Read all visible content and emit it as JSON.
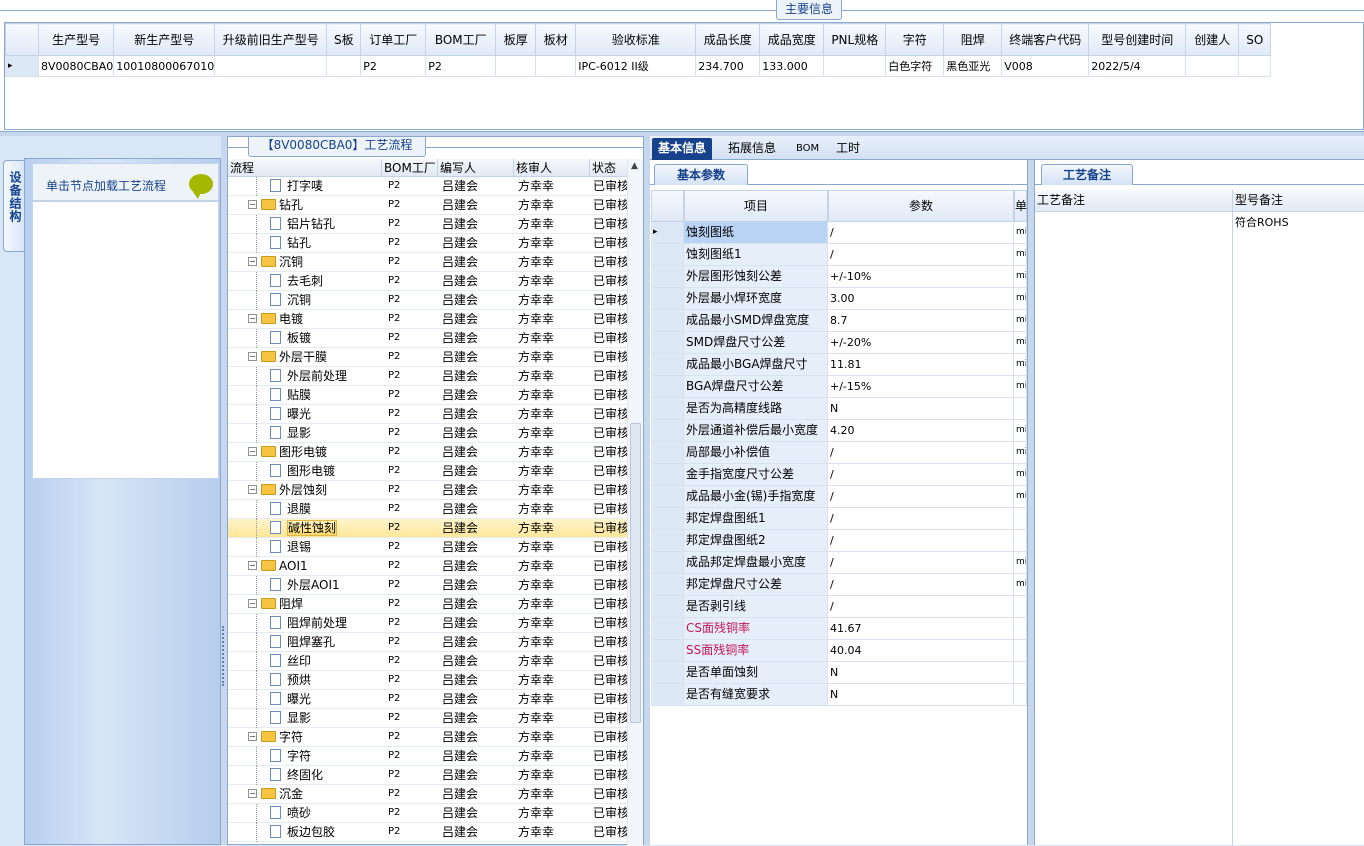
{
  "main_info": {
    "title": "主要信息",
    "columns": [
      "生产型号",
      "新生产型号",
      "升级前旧生产型号",
      "S板",
      "订单工厂",
      "BOM工厂",
      "板厚",
      "板材",
      "验收标准",
      "成品长度",
      "成品宽度",
      "PNL规格",
      "字符",
      "阻焊",
      "终端客户代码",
      "型号创建时间",
      "创建人",
      "SO"
    ],
    "row": [
      "8V0080CBA0",
      "10010800067010",
      "",
      "",
      "P2",
      "P2",
      "",
      "",
      "IPC-6012 II级",
      "234.700",
      "133.000",
      "",
      "白色字符",
      "黑色亚光",
      "V008",
      "2022/5/4",
      "",
      ""
    ]
  },
  "left_panel": {
    "tab_label": "设备结构",
    "hint": "单击节点加载工艺流程"
  },
  "flow_panel": {
    "title": "【8V0080CBA0】工艺流程",
    "columns": [
      "流程",
      "BOM工厂",
      "编写人",
      "核审人",
      "状态"
    ],
    "rows": [
      {
        "name": "打字唛",
        "level": 2,
        "type": "doc",
        "bom": "P2",
        "writer": "吕建会",
        "reviewer": "方幸幸",
        "status": "已审核"
      },
      {
        "name": "钻孔",
        "level": 1,
        "type": "folder",
        "bom": "P2",
        "writer": "吕建会",
        "reviewer": "方幸幸",
        "status": "已审核"
      },
      {
        "name": "铝片钻孔",
        "level": 2,
        "type": "doc",
        "bom": "P2",
        "writer": "吕建会",
        "reviewer": "方幸幸",
        "status": "已审核"
      },
      {
        "name": "钻孔",
        "level": 2,
        "type": "doc",
        "bom": "P2",
        "writer": "吕建会",
        "reviewer": "方幸幸",
        "status": "已审核"
      },
      {
        "name": "沉铜",
        "level": 1,
        "type": "folder",
        "bom": "P2",
        "writer": "吕建会",
        "reviewer": "方幸幸",
        "status": "已审核"
      },
      {
        "name": "去毛刺",
        "level": 2,
        "type": "doc",
        "bom": "P2",
        "writer": "吕建会",
        "reviewer": "方幸幸",
        "status": "已审核"
      },
      {
        "name": "沉铜",
        "level": 2,
        "type": "doc",
        "bom": "P2",
        "writer": "吕建会",
        "reviewer": "方幸幸",
        "status": "已审核"
      },
      {
        "name": "电镀",
        "level": 1,
        "type": "folder",
        "bom": "P2",
        "writer": "吕建会",
        "reviewer": "方幸幸",
        "status": "已审核"
      },
      {
        "name": "板镀",
        "level": 2,
        "type": "doc",
        "bom": "P2",
        "writer": "吕建会",
        "reviewer": "方幸幸",
        "status": "已审核"
      },
      {
        "name": "外层干膜",
        "level": 1,
        "type": "folder",
        "bom": "P2",
        "writer": "吕建会",
        "reviewer": "方幸幸",
        "status": "已审核"
      },
      {
        "name": "外层前处理",
        "level": 2,
        "type": "doc",
        "bom": "P2",
        "writer": "吕建会",
        "reviewer": "方幸幸",
        "status": "已审核"
      },
      {
        "name": "贴膜",
        "level": 2,
        "type": "doc",
        "bom": "P2",
        "writer": "吕建会",
        "reviewer": "方幸幸",
        "status": "已审核"
      },
      {
        "name": "曝光",
        "level": 2,
        "type": "doc",
        "bom": "P2",
        "writer": "吕建会",
        "reviewer": "方幸幸",
        "status": "已审核"
      },
      {
        "name": "显影",
        "level": 2,
        "type": "doc",
        "bom": "P2",
        "writer": "吕建会",
        "reviewer": "方幸幸",
        "status": "已审核"
      },
      {
        "name": "图形电镀",
        "level": 1,
        "type": "folder",
        "bom": "P2",
        "writer": "吕建会",
        "reviewer": "方幸幸",
        "status": "已审核"
      },
      {
        "name": "图形电镀",
        "level": 2,
        "type": "doc",
        "bom": "P2",
        "writer": "吕建会",
        "reviewer": "方幸幸",
        "status": "已审核"
      },
      {
        "name": "外层蚀刻",
        "level": 1,
        "type": "folder",
        "bom": "P2",
        "writer": "吕建会",
        "reviewer": "方幸幸",
        "status": "已审核"
      },
      {
        "name": "退膜",
        "level": 2,
        "type": "doc",
        "bom": "P2",
        "writer": "吕建会",
        "reviewer": "方幸幸",
        "status": "已审核"
      },
      {
        "name": "碱性蚀刻",
        "level": 2,
        "type": "doc",
        "bom": "P2",
        "writer": "吕建会",
        "reviewer": "方幸幸",
        "status": "已审核",
        "selected": true
      },
      {
        "name": "退锡",
        "level": 2,
        "type": "doc",
        "bom": "P2",
        "writer": "吕建会",
        "reviewer": "方幸幸",
        "status": "已审核"
      },
      {
        "name": "AOI1",
        "level": 1,
        "type": "folder",
        "bom": "P2",
        "writer": "吕建会",
        "reviewer": "方幸幸",
        "status": "已审核"
      },
      {
        "name": "外层AOI1",
        "level": 2,
        "type": "doc",
        "bom": "P2",
        "writer": "吕建会",
        "reviewer": "方幸幸",
        "status": "已审核"
      },
      {
        "name": "阻焊",
        "level": 1,
        "type": "folder",
        "bom": "P2",
        "writer": "吕建会",
        "reviewer": "方幸幸",
        "status": "已审核"
      },
      {
        "name": "阻焊前处理",
        "level": 2,
        "type": "doc",
        "bom": "P2",
        "writer": "吕建会",
        "reviewer": "方幸幸",
        "status": "已审核"
      },
      {
        "name": "阻焊塞孔",
        "level": 2,
        "type": "doc",
        "bom": "P2",
        "writer": "吕建会",
        "reviewer": "方幸幸",
        "status": "已审核"
      },
      {
        "name": "丝印",
        "level": 2,
        "type": "doc",
        "bom": "P2",
        "writer": "吕建会",
        "reviewer": "方幸幸",
        "status": "已审核"
      },
      {
        "name": "预烘",
        "level": 2,
        "type": "doc",
        "bom": "P2",
        "writer": "吕建会",
        "reviewer": "方幸幸",
        "status": "已审核"
      },
      {
        "name": "曝光",
        "level": 2,
        "type": "doc",
        "bom": "P2",
        "writer": "吕建会",
        "reviewer": "方幸幸",
        "status": "已审核"
      },
      {
        "name": "显影",
        "level": 2,
        "type": "doc",
        "bom": "P2",
        "writer": "吕建会",
        "reviewer": "方幸幸",
        "status": "已审核"
      },
      {
        "name": "字符",
        "level": 1,
        "type": "folder",
        "bom": "P2",
        "writer": "吕建会",
        "reviewer": "方幸幸",
        "status": "已审核"
      },
      {
        "name": "字符",
        "level": 2,
        "type": "doc",
        "bom": "P2",
        "writer": "吕建会",
        "reviewer": "方幸幸",
        "status": "已审核"
      },
      {
        "name": "终固化",
        "level": 2,
        "type": "doc",
        "bom": "P2",
        "writer": "吕建会",
        "reviewer": "方幸幸",
        "status": "已审核"
      },
      {
        "name": "沉金",
        "level": 1,
        "type": "folder",
        "bom": "P2",
        "writer": "吕建会",
        "reviewer": "方幸幸",
        "status": "已审核"
      },
      {
        "name": "喷砂",
        "level": 2,
        "type": "doc",
        "bom": "P2",
        "writer": "吕建会",
        "reviewer": "方幸幸",
        "status": "已审核"
      },
      {
        "name": "板边包胶",
        "level": 2,
        "type": "doc",
        "bom": "P2",
        "writer": "吕建会",
        "reviewer": "方幸幸",
        "status": "已审核"
      }
    ]
  },
  "right_tabs": [
    "基本信息",
    "拓展信息",
    "BOM",
    "工时"
  ],
  "params": {
    "group_title": "基本参数",
    "columns": [
      "项目",
      "参数",
      "单"
    ],
    "rows": [
      {
        "key": "蚀刻图纸",
        "value": "/",
        "unit": "mi",
        "selected": true
      },
      {
        "key": "蚀刻图纸1",
        "value": "/",
        "unit": "mi"
      },
      {
        "key": "外层图形蚀刻公差",
        "value": "+/-10%",
        "unit": "mi"
      },
      {
        "key": "外层最小焊环宽度",
        "value": "3.00",
        "unit": "mi"
      },
      {
        "key": "成品最小SMD焊盘宽度",
        "value": "8.7",
        "unit": "mi"
      },
      {
        "key": "SMD焊盘尺寸公差",
        "value": "+/-20%",
        "unit": "mi"
      },
      {
        "key": "成品最小BGA焊盘尺寸",
        "value": "11.81",
        "unit": "mi"
      },
      {
        "key": "BGA焊盘尺寸公差",
        "value": "+/-15%",
        "unit": "mi"
      },
      {
        "key": "是否为高精度线路",
        "value": "N",
        "unit": ""
      },
      {
        "key": "外层通道补偿后最小宽度",
        "value": "4.20",
        "unit": "mi"
      },
      {
        "key": "局部最小补偿值",
        "value": "/",
        "unit": "mi"
      },
      {
        "key": "金手指宽度尺寸公差",
        "value": "/",
        "unit": "mi"
      },
      {
        "key": "成品最小金(锡)手指宽度",
        "value": "/",
        "unit": "mi"
      },
      {
        "key": "邦定焊盘图纸1",
        "value": "/",
        "unit": ""
      },
      {
        "key": "邦定焊盘图纸2",
        "value": "/",
        "unit": ""
      },
      {
        "key": "成品邦定焊盘最小宽度",
        "value": "/",
        "unit": "mi"
      },
      {
        "key": "邦定焊盘尺寸公差",
        "value": "/",
        "unit": "mi"
      },
      {
        "key": "是否剥引线",
        "value": "/",
        "unit": ""
      },
      {
        "key": "CS面残铜率",
        "value": "41.67",
        "unit": "",
        "pink": true
      },
      {
        "key": "SS面残铜率",
        "value": "40.04",
        "unit": "",
        "pink": true
      },
      {
        "key": "是否单面蚀刻",
        "value": "N",
        "unit": ""
      },
      {
        "key": "是否有缝宽要求",
        "value": "N",
        "unit": ""
      }
    ]
  },
  "remarks": {
    "group_title": "工艺备注",
    "col1_header": "工艺备注",
    "col2_header": "型号备注",
    "col2_text": "符合ROHS"
  }
}
